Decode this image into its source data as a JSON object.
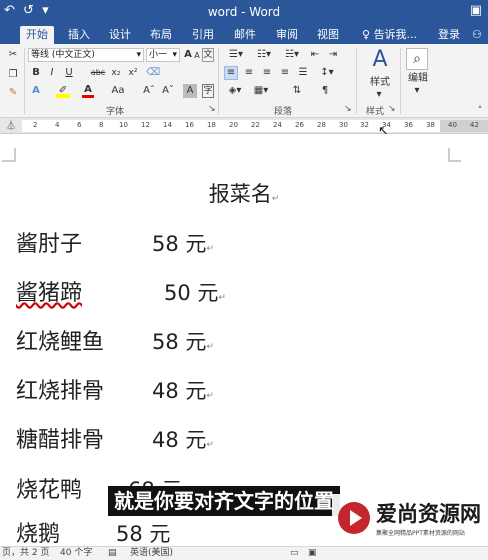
{
  "titlebar": {
    "title": "word - Word",
    "undo": "↶",
    "redo": "↺"
  },
  "tabs": {
    "items": [
      "开始",
      "插入",
      "设计",
      "布局",
      "引用",
      "邮件",
      "审阅",
      "视图"
    ],
    "tell_me": "告诉我...",
    "login": "登录"
  },
  "ribbon": {
    "font_name": "等线 (中文正文)",
    "font_size": "小一",
    "font_grow": "A",
    "font_shrink": "A",
    "bold": "B",
    "italic": "I",
    "underline": "U",
    "strike": "abc",
    "subscript": "x₂",
    "superscript": "x²",
    "aa": "Aa",
    "wen": "文",
    "groups": {
      "font": "字体",
      "paragraph": "段落",
      "styles": "样式",
      "edit": "编辑"
    },
    "styles_button": "样式",
    "edit_button": "编辑"
  },
  "ruler": {
    "numbers": [
      "2",
      "4",
      "6",
      "8",
      "10",
      "12",
      "14",
      "16",
      "18",
      "20",
      "22",
      "24",
      "26",
      "28",
      "30",
      "32",
      "34",
      "36",
      "38",
      "40",
      "42"
    ]
  },
  "document": {
    "title": "报菜名",
    "paragraph_mark": "↵",
    "items": [
      {
        "name": "酱肘子",
        "price": "58 元"
      },
      {
        "name": "酱猪蹄",
        "price": "50 元"
      },
      {
        "name": "红烧鲤鱼",
        "price": "58 元"
      },
      {
        "name": "红烧排骨",
        "price": "48 元"
      },
      {
        "name": "糖醋排骨",
        "price": "48 元"
      },
      {
        "name": "烧花鸭",
        "price": "68 元"
      },
      {
        "name": "烧鹅",
        "price": "58 元"
      }
    ]
  },
  "subtitle": "就是你要对齐文字的位置",
  "watermark": {
    "big": "爱尚资源网",
    "small": "集聚全网精品PPT素材资源的网站"
  },
  "status": {
    "pages": "页，共 2 页",
    "words": "40 个字",
    "language": "英语(美国)"
  },
  "colors": {
    "word_blue": "#2b579a",
    "ribbon_bg": "#f3f3f3",
    "logo_red": "#c4262e"
  }
}
